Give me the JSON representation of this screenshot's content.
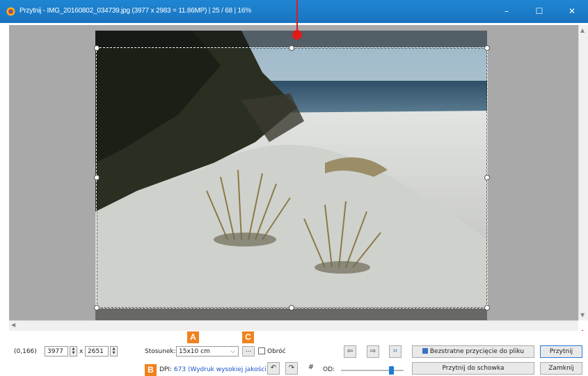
{
  "window": {
    "title": "Przytnij  -  IMG_20160802_034739.jpg  (3977 x 2983 = 11.86MP)  | 25 / 68 |  16%",
    "min_glyph": "–",
    "max_glyph": "☐",
    "close_glyph": "✕",
    "accent": "#1a7cc9"
  },
  "callouts": {
    "a": "A",
    "b": "B",
    "c": "C"
  },
  "controls": {
    "coords": "(0,166)",
    "width_value": "3977",
    "times": "x",
    "height_value": "2651",
    "ratio_label": "Stosunek:",
    "ratio_value": "15x10 cm",
    "ratio_more": "...",
    "rotate_label": "Obróć",
    "dpi_prefix": "DPI:",
    "dpi_value": "673 (Wydruk wysokiej jakości)",
    "od_label": "OD:",
    "lossless_label": "Bezstratne przycięcie do pliku",
    "crop_label": "Przytnij",
    "clipboard_label": "Przytnij do schowka",
    "close_label": "Zamknij",
    "slider_fraction": 0.8
  },
  "icons": {
    "prev": "⇦",
    "next": "⇨",
    "fit": "⌗",
    "rotate_left": "↶",
    "rotate_right": "↷",
    "grid": "#",
    "save": "save-icon"
  }
}
